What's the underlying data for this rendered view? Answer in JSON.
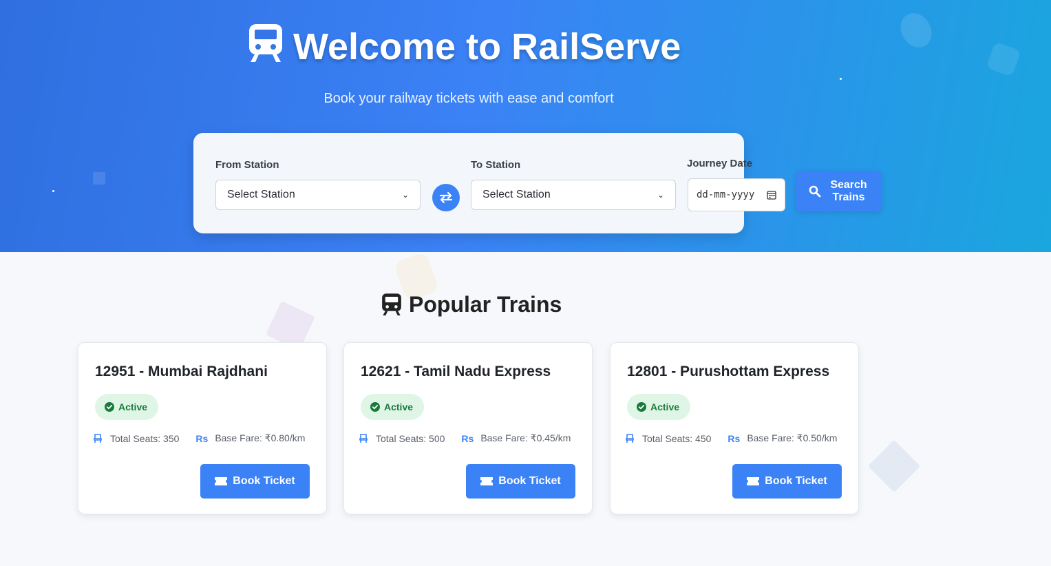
{
  "hero": {
    "title": "Welcome to RailServe",
    "subtitle": "Book your railway tickets with ease and comfort"
  },
  "search": {
    "from_label": "From Station",
    "from_value": "Select Station",
    "to_label": "To Station",
    "to_value": "Select Station",
    "date_label": "Journey Date",
    "date_placeholder": "dd-mm-yyyy",
    "search_button": "Search Trains"
  },
  "popular": {
    "title": "Popular Trains",
    "trains": [
      {
        "title": "12951 - Mumbai Rajdhani",
        "status": "Active",
        "seats": "Total Seats: 350",
        "fare": "Base Fare: ₹0.80/km",
        "button": "Book Ticket"
      },
      {
        "title": "12621 - Tamil Nadu Express",
        "status": "Active",
        "seats": "Total Seats: 500",
        "fare": "Base Fare: ₹0.45/km",
        "button": "Book Ticket"
      },
      {
        "title": "12801 - Purushottam Express",
        "status": "Active",
        "seats": "Total Seats: 450",
        "fare": "Base Fare: ₹0.50/km",
        "button": "Book Ticket"
      }
    ]
  },
  "icons": {
    "train": "train-icon",
    "swap": "swap-icon",
    "calendar": "calendar-icon",
    "search": "search-icon",
    "check": "check-circle-icon",
    "seat": "seat-icon",
    "rupee": "rupee-icon",
    "ticket": "ticket-icon"
  },
  "colors": {
    "primary": "#3b82f6",
    "active_badge_bg": "#dff6e6",
    "active_badge_text": "#1a7a3c"
  }
}
